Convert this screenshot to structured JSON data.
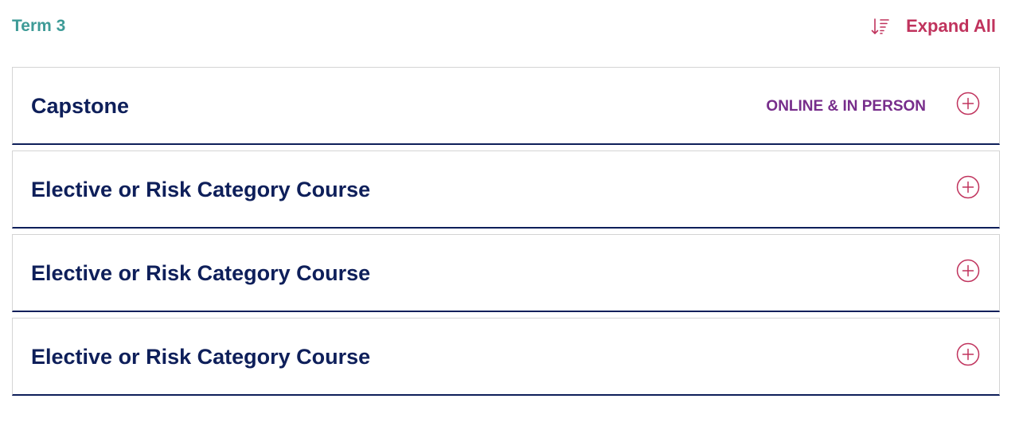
{
  "header": {
    "term_title": "Term 3",
    "expand_all_label": "Expand All",
    "expand_icon": "sort-descending-icon"
  },
  "courses": [
    {
      "title": "Capstone",
      "badge": "ONLINE & IN PERSON"
    },
    {
      "title": "Elective or Risk Category Course",
      "badge": ""
    },
    {
      "title": "Elective or Risk Category Course",
      "badge": ""
    },
    {
      "title": "Elective or Risk Category Course",
      "badge": ""
    }
  ],
  "colors": {
    "term_title": "#3e9b97",
    "accent": "#c0335d",
    "course_title": "#0e1f5a",
    "badge": "#772d8b",
    "border": "#d4d4d4"
  },
  "icons": {
    "item_toggle": "plus-circle-icon"
  }
}
